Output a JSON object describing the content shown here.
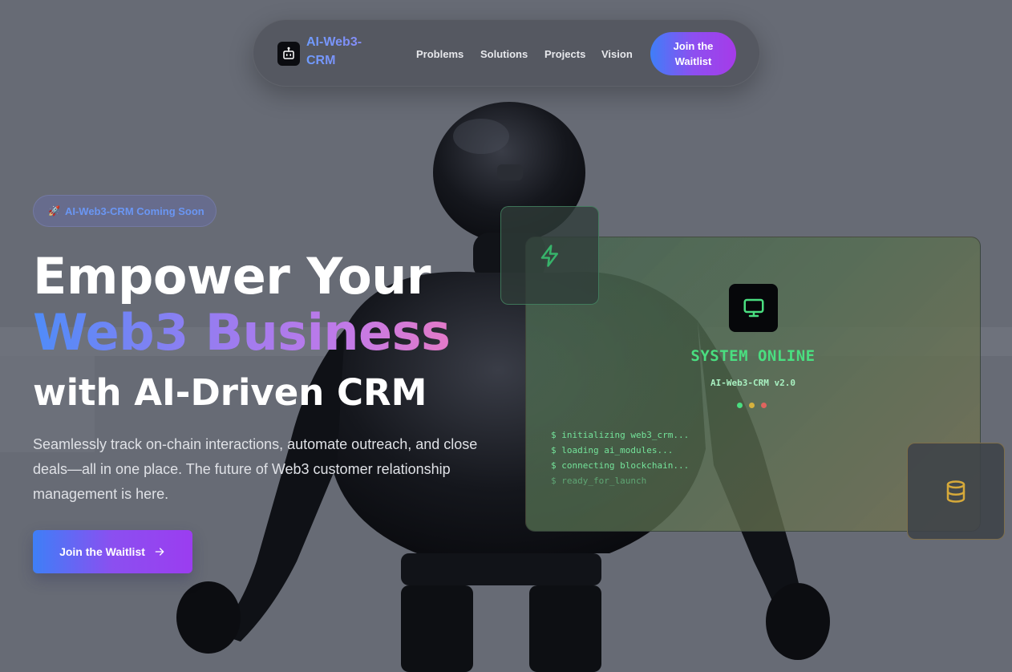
{
  "nav": {
    "brand": "AI-Web3-CRM",
    "links": [
      "Problems",
      "Solutions",
      "Projects",
      "Vision"
    ],
    "cta": "Join the Waitlist"
  },
  "hero": {
    "badge": "AI-Web3-CRM Coming Soon",
    "title_line1": "Empower Your",
    "title_line2": "Web3 Business",
    "title_line3": "with AI-Driven CRM",
    "description": "Seamlessly track on-chain interactions, automate outreach, and close deals—all in one place. The future of Web3 customer relationship management is here.",
    "cta": "Join the Waitlist"
  },
  "terminal": {
    "status": "SYSTEM ONLINE",
    "version": "AI-Web3-CRM v2.0",
    "status_dots": [
      "#4ade80",
      "#d6b23e",
      "#e0645e"
    ],
    "log": [
      "$ initializing web3_crm...",
      "$ loading ai_modules...",
      "$ connecting blockchain...",
      "$ ready_for_launch"
    ]
  },
  "icons": {
    "logo": "robot-icon",
    "badge": "rocket-icon",
    "cta": "arrow-right-icon",
    "panel_left": "lightning-icon",
    "terminal": "monitor-icon",
    "panel_right": "database-icon"
  },
  "colors": {
    "accent_blue": "#3f7ef8",
    "accent_purple": "#9b3df0",
    "terminal_green": "#4ade80",
    "database_gold": "#d6a93a"
  }
}
